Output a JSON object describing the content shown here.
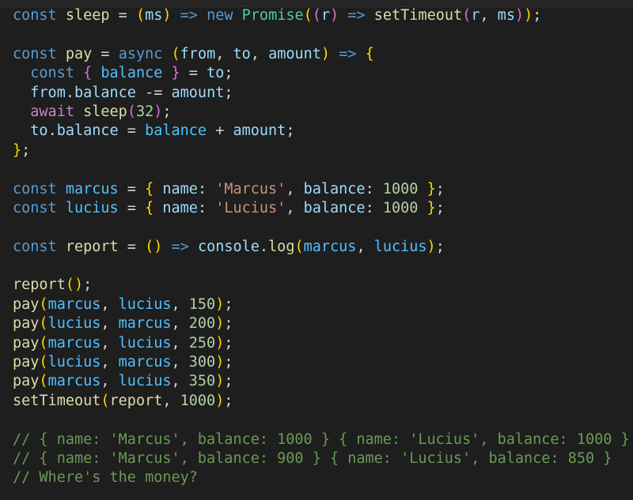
{
  "editor": {
    "theme": {
      "background": "#1e1e1e",
      "default": "#d4d4d4",
      "keyword": "#569cd6",
      "control": "#c586c0",
      "variable": "#9cdcfe",
      "constant": "#4fc1ff",
      "function": "#dcdcaa",
      "class": "#4ec9b0",
      "string": "#ce9178",
      "number": "#b5cea8",
      "comment": "#6a9955",
      "bracket1": "#ffd700",
      "bracket2": "#da70d6",
      "bracket3": "#179fff"
    },
    "lines": [
      [
        [
          "const",
          "keyword"
        ],
        [
          " ",
          "default"
        ],
        [
          "sleep",
          "function"
        ],
        [
          " = ",
          "default"
        ],
        [
          "(",
          "bracket1"
        ],
        [
          "ms",
          "variable"
        ],
        [
          ")",
          "bracket1"
        ],
        [
          " ",
          "default"
        ],
        [
          "=>",
          "keyword"
        ],
        [
          " ",
          "default"
        ],
        [
          "new",
          "keyword"
        ],
        [
          " ",
          "default"
        ],
        [
          "Promise",
          "class"
        ],
        [
          "(",
          "bracket1"
        ],
        [
          "(",
          "bracket2"
        ],
        [
          "r",
          "variable"
        ],
        [
          ")",
          "bracket2"
        ],
        [
          " ",
          "default"
        ],
        [
          "=>",
          "keyword"
        ],
        [
          " ",
          "default"
        ],
        [
          "setTimeout",
          "function"
        ],
        [
          "(",
          "bracket2"
        ],
        [
          "r",
          "variable"
        ],
        [
          ", ",
          "default"
        ],
        [
          "ms",
          "variable"
        ],
        [
          ")",
          "bracket2"
        ],
        [
          ")",
          "bracket1"
        ],
        [
          ";",
          "default"
        ]
      ],
      [],
      [
        [
          "const",
          "keyword"
        ],
        [
          " ",
          "default"
        ],
        [
          "pay",
          "function"
        ],
        [
          " = ",
          "default"
        ],
        [
          "async",
          "keyword"
        ],
        [
          " ",
          "default"
        ],
        [
          "(",
          "bracket1"
        ],
        [
          "from",
          "variable"
        ],
        [
          ", ",
          "default"
        ],
        [
          "to",
          "variable"
        ],
        [
          ", ",
          "default"
        ],
        [
          "amount",
          "variable"
        ],
        [
          ")",
          "bracket1"
        ],
        [
          " ",
          "default"
        ],
        [
          "=>",
          "keyword"
        ],
        [
          " ",
          "default"
        ],
        [
          "{",
          "bracket1"
        ]
      ],
      [
        [
          "  ",
          "default"
        ],
        [
          "const",
          "keyword"
        ],
        [
          " ",
          "default"
        ],
        [
          "{",
          "bracket2"
        ],
        [
          " ",
          "default"
        ],
        [
          "balance",
          "constant"
        ],
        [
          " ",
          "default"
        ],
        [
          "}",
          "bracket2"
        ],
        [
          " = ",
          "default"
        ],
        [
          "to",
          "variable"
        ],
        [
          ";",
          "default"
        ]
      ],
      [
        [
          "  ",
          "default"
        ],
        [
          "from",
          "variable"
        ],
        [
          ".",
          "default"
        ],
        [
          "balance",
          "variable"
        ],
        [
          " -= ",
          "default"
        ],
        [
          "amount",
          "variable"
        ],
        [
          ";",
          "default"
        ]
      ],
      [
        [
          "  ",
          "default"
        ],
        [
          "await",
          "control"
        ],
        [
          " ",
          "default"
        ],
        [
          "sleep",
          "function"
        ],
        [
          "(",
          "bracket2"
        ],
        [
          "32",
          "number"
        ],
        [
          ")",
          "bracket2"
        ],
        [
          ";",
          "default"
        ]
      ],
      [
        [
          "  ",
          "default"
        ],
        [
          "to",
          "variable"
        ],
        [
          ".",
          "default"
        ],
        [
          "balance",
          "variable"
        ],
        [
          " = ",
          "default"
        ],
        [
          "balance",
          "constant"
        ],
        [
          " + ",
          "default"
        ],
        [
          "amount",
          "variable"
        ],
        [
          ";",
          "default"
        ]
      ],
      [
        [
          "}",
          "bracket1"
        ],
        [
          ";",
          "default"
        ]
      ],
      [],
      [
        [
          "const",
          "keyword"
        ],
        [
          " ",
          "default"
        ],
        [
          "marcus",
          "constant"
        ],
        [
          " = ",
          "default"
        ],
        [
          "{",
          "bracket1"
        ],
        [
          " ",
          "default"
        ],
        [
          "name",
          "variable"
        ],
        [
          ": ",
          "default"
        ],
        [
          "'Marcus'",
          "string"
        ],
        [
          ", ",
          "default"
        ],
        [
          "balance",
          "variable"
        ],
        [
          ": ",
          "default"
        ],
        [
          "1000",
          "number"
        ],
        [
          " ",
          "default"
        ],
        [
          "}",
          "bracket1"
        ],
        [
          ";",
          "default"
        ]
      ],
      [
        [
          "const",
          "keyword"
        ],
        [
          " ",
          "default"
        ],
        [
          "lucius",
          "constant"
        ],
        [
          " = ",
          "default"
        ],
        [
          "{",
          "bracket1"
        ],
        [
          " ",
          "default"
        ],
        [
          "name",
          "variable"
        ],
        [
          ": ",
          "default"
        ],
        [
          "'Lucius'",
          "string"
        ],
        [
          ", ",
          "default"
        ],
        [
          "balance",
          "variable"
        ],
        [
          ": ",
          "default"
        ],
        [
          "1000",
          "number"
        ],
        [
          " ",
          "default"
        ],
        [
          "}",
          "bracket1"
        ],
        [
          ";",
          "default"
        ]
      ],
      [],
      [
        [
          "const",
          "keyword"
        ],
        [
          " ",
          "default"
        ],
        [
          "report",
          "function"
        ],
        [
          " = ",
          "default"
        ],
        [
          "()",
          "bracket1"
        ],
        [
          " ",
          "default"
        ],
        [
          "=>",
          "keyword"
        ],
        [
          " ",
          "default"
        ],
        [
          "console",
          "variable"
        ],
        [
          ".",
          "default"
        ],
        [
          "log",
          "function"
        ],
        [
          "(",
          "bracket1"
        ],
        [
          "marcus",
          "constant"
        ],
        [
          ", ",
          "default"
        ],
        [
          "lucius",
          "constant"
        ],
        [
          ")",
          "bracket1"
        ],
        [
          ";",
          "default"
        ]
      ],
      [],
      [
        [
          "report",
          "function"
        ],
        [
          "()",
          "bracket1"
        ],
        [
          ";",
          "default"
        ]
      ],
      [
        [
          "pay",
          "function"
        ],
        [
          "(",
          "bracket1"
        ],
        [
          "marcus",
          "constant"
        ],
        [
          ", ",
          "default"
        ],
        [
          "lucius",
          "constant"
        ],
        [
          ", ",
          "default"
        ],
        [
          "150",
          "number"
        ],
        [
          ")",
          "bracket1"
        ],
        [
          ";",
          "default"
        ]
      ],
      [
        [
          "pay",
          "function"
        ],
        [
          "(",
          "bracket1"
        ],
        [
          "lucius",
          "constant"
        ],
        [
          ", ",
          "default"
        ],
        [
          "marcus",
          "constant"
        ],
        [
          ", ",
          "default"
        ],
        [
          "200",
          "number"
        ],
        [
          ")",
          "bracket1"
        ],
        [
          ";",
          "default"
        ]
      ],
      [
        [
          "pay",
          "function"
        ],
        [
          "(",
          "bracket1"
        ],
        [
          "marcus",
          "constant"
        ],
        [
          ", ",
          "default"
        ],
        [
          "lucius",
          "constant"
        ],
        [
          ", ",
          "default"
        ],
        [
          "250",
          "number"
        ],
        [
          ")",
          "bracket1"
        ],
        [
          ";",
          "default"
        ]
      ],
      [
        [
          "pay",
          "function"
        ],
        [
          "(",
          "bracket1"
        ],
        [
          "lucius",
          "constant"
        ],
        [
          ", ",
          "default"
        ],
        [
          "marcus",
          "constant"
        ],
        [
          ", ",
          "default"
        ],
        [
          "300",
          "number"
        ],
        [
          ")",
          "bracket1"
        ],
        [
          ";",
          "default"
        ]
      ],
      [
        [
          "pay",
          "function"
        ],
        [
          "(",
          "bracket1"
        ],
        [
          "marcus",
          "constant"
        ],
        [
          ", ",
          "default"
        ],
        [
          "lucius",
          "constant"
        ],
        [
          ", ",
          "default"
        ],
        [
          "350",
          "number"
        ],
        [
          ")",
          "bracket1"
        ],
        [
          ";",
          "default"
        ]
      ],
      [
        [
          "setTimeout",
          "function"
        ],
        [
          "(",
          "bracket1"
        ],
        [
          "report",
          "function"
        ],
        [
          ", ",
          "default"
        ],
        [
          "1000",
          "number"
        ],
        [
          ")",
          "bracket1"
        ],
        [
          ";",
          "default"
        ]
      ],
      [],
      [
        [
          "// { name: 'Marcus', balance: 1000 } { name: 'Lucius', balance: 1000 }",
          "comment"
        ]
      ],
      [
        [
          "// { name: 'Marcus', balance: 900 } { name: 'Lucius', balance: 850 }",
          "comment"
        ]
      ],
      [
        [
          "// Where's the money?",
          "comment"
        ]
      ]
    ]
  }
}
